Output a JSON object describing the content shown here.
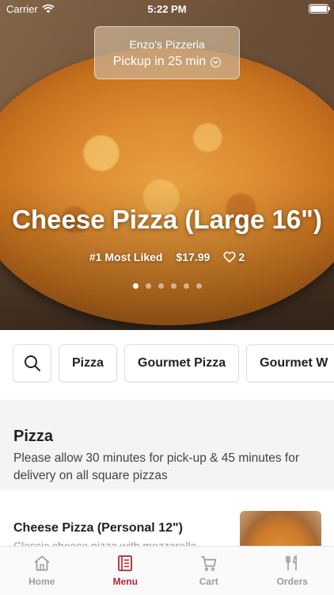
{
  "status_bar": {
    "carrier": "Carrier",
    "time": "5:22 PM"
  },
  "store": {
    "name": "Enzo's Pizzeria",
    "pickup": "Pickup in 25 min"
  },
  "hero": {
    "title": "Cheese Pizza (Large 16\")",
    "badge": "#1 Most Liked",
    "price": "$17.99",
    "likes": "2",
    "slide_count": 6,
    "active_slide": 1
  },
  "categories": {
    "search_icon": "search-icon",
    "items": [
      "Pizza",
      "Gourmet Pizza",
      "Gourmet W"
    ]
  },
  "section": {
    "title": "Pizza",
    "description": "Please allow 30 minutes for pick-up & 45 minutes for delivery on all square pizzas"
  },
  "menu_item": {
    "name": "Cheese Pizza (Personal 12\")",
    "description": "Classic cheese pizza with mozzarella"
  },
  "tabbar": {
    "tabs": [
      {
        "label": "Home",
        "icon": "home-icon"
      },
      {
        "label": "Menu",
        "icon": "menu-icon",
        "active": true
      },
      {
        "label": "Cart",
        "icon": "cart-icon"
      },
      {
        "label": "Orders",
        "icon": "orders-icon"
      }
    ]
  },
  "colors": {
    "accent": "#b3232e",
    "inactive_tab": "#9c9c9c"
  }
}
